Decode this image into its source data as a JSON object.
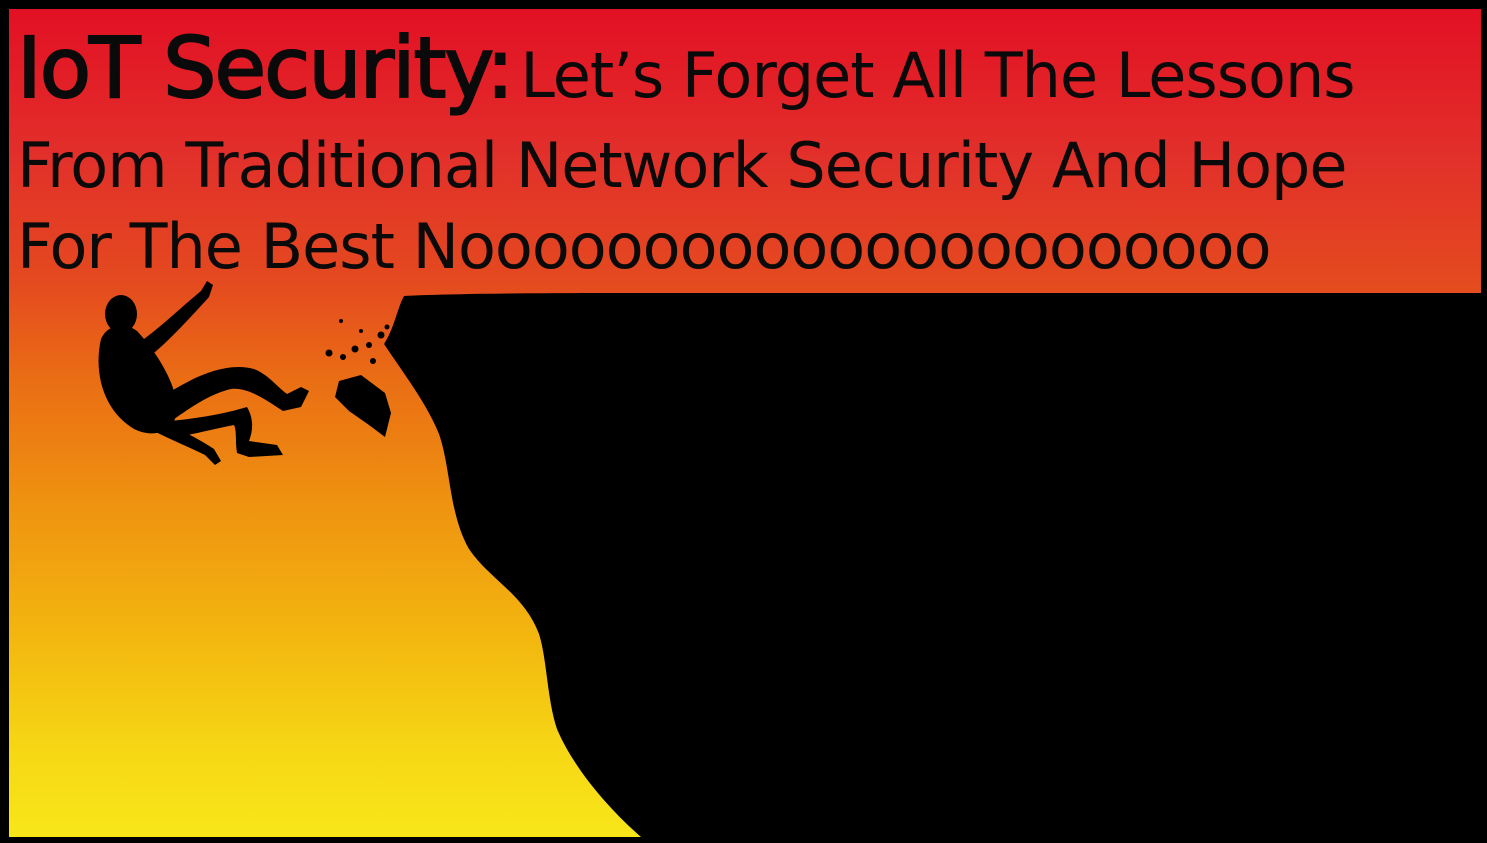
{
  "slide": {
    "title_bold": "IoT Security:",
    "title_line1": "Let’s Forget All The Lessons",
    "title_line2": "From Traditional Network Security And Hope",
    "title_line3": "For The Best Noooooooooooooooooooooo"
  },
  "illustration": {
    "subject": "silhouette of a person falling off a cliff edge with crumbling rocks",
    "icons": [
      "falling-person-icon",
      "cliff-silhouette",
      "rock-debris"
    ]
  },
  "colors": {
    "gradient_top": "#e21024",
    "gradient_mid": "#ef9310",
    "gradient_bottom": "#f8e619",
    "silhouette": "#000000",
    "text": "#0a0a0a"
  }
}
